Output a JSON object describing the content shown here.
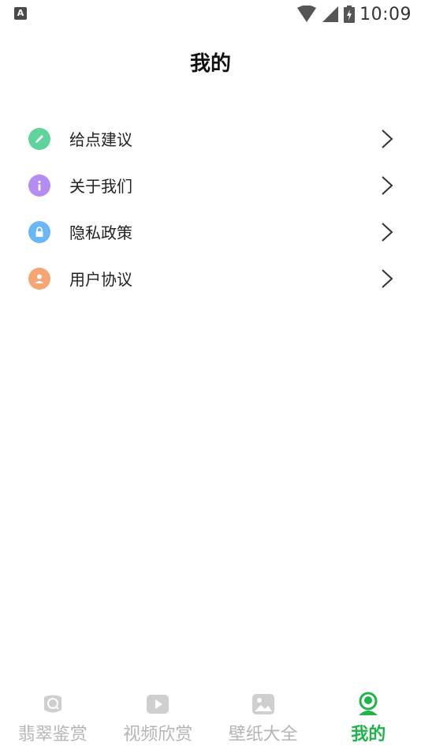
{
  "status_bar": {
    "app_icon_letter": "A",
    "time": "10:09"
  },
  "header": {
    "title": "我的"
  },
  "menu": {
    "items": [
      {
        "label": "给点建议",
        "icon": "pencil-icon",
        "color": "#5fd39b"
      },
      {
        "label": "关于我们",
        "icon": "info-icon",
        "color": "#b58cf2"
      },
      {
        "label": "隐私政策",
        "icon": "lock-icon",
        "color": "#6ab6f7"
      },
      {
        "label": "用户协议",
        "icon": "user-icon",
        "color": "#f5a672"
      }
    ]
  },
  "tab_bar": {
    "active_color": "#1fb44a",
    "inactive_color": "#b5b5b5",
    "tabs": [
      {
        "label": "翡翠鉴赏",
        "icon": "search-icon",
        "active": false
      },
      {
        "label": "视频欣赏",
        "icon": "play-icon",
        "active": false
      },
      {
        "label": "壁纸大全",
        "icon": "image-icon",
        "active": false
      },
      {
        "label": "我的",
        "icon": "profile-icon",
        "active": true
      }
    ]
  }
}
